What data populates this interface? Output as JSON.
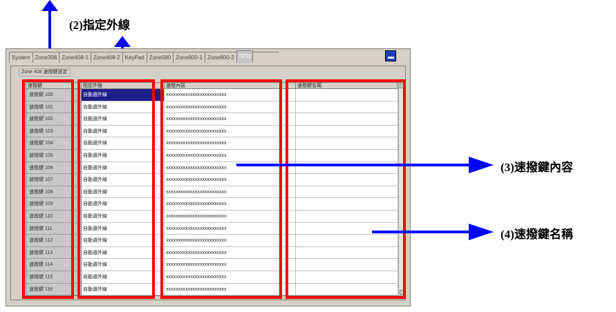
{
  "window": {
    "tabs": [
      "System",
      "Zone308",
      "Zone408-1",
      "Zone408-2",
      "KeyPad",
      "Zone580",
      "Zone600-1",
      "Zone600-2",
      "SPD"
    ],
    "active_tab": "SPD",
    "group_label": "Zone 408 速撥鍵設定"
  },
  "grid": {
    "columns": [
      "速撥鍵",
      "指定外線",
      "速撥內容",
      "速撥鍵名稱"
    ],
    "rows": [
      {
        "key": "速撥鍵 100",
        "line": "自動選外線",
        "content": "xxxxxxxxxxxxxxxxxxxxxxxxx",
        "name": ""
      },
      {
        "key": "速撥鍵 101",
        "line": "自動選外線",
        "content": "xxxxxxxxxxxxxxxxxxxxxxxxx",
        "name": ""
      },
      {
        "key": "速撥鍵 102",
        "line": "自動選外線",
        "content": "xxxxxxxxxxxxxxxxxxxxxxxxx",
        "name": ""
      },
      {
        "key": "速撥鍵 103",
        "line": "自動選外線",
        "content": "xxxxxxxxxxxxxxxxxxxxxxxxx",
        "name": ""
      },
      {
        "key": "速撥鍵 104",
        "line": "自動選外線",
        "content": "xxxxxxxxxxxxxxxxxxxxxxxxx",
        "name": ""
      },
      {
        "key": "速撥鍵 105",
        "line": "自動選外線",
        "content": "xxxxxxxxxxxxxxxxxxxxxxxxx",
        "name": ""
      },
      {
        "key": "速撥鍵 106",
        "line": "自動選外線",
        "content": "xxxxxxxxxxxxxxxxxxxxxxxxx",
        "name": ""
      },
      {
        "key": "速撥鍵 107",
        "line": "自動選外線",
        "content": "xxxxxxxxxxxxxxxxxxxxxxxxx",
        "name": ""
      },
      {
        "key": "速撥鍵 108",
        "line": "自動選外線",
        "content": "xxxxxxxxxxxxxxxxxxxxxxxxx",
        "name": ""
      },
      {
        "key": "速撥鍵 109",
        "line": "自動選外線",
        "content": "xxxxxxxxxxxxxxxxxxxxxxxxx",
        "name": ""
      },
      {
        "key": "速撥鍵 110",
        "line": "自動選外線",
        "content": "xxxxxxxxxxxxxxxxxxxxxxxxx",
        "name": ""
      },
      {
        "key": "速撥鍵 111",
        "line": "自動選外線",
        "content": "xxxxxxxxxxxxxxxxxxxxxxxxx",
        "name": ""
      },
      {
        "key": "速撥鍵 112",
        "line": "自動選外線",
        "content": "xxxxxxxxxxxxxxxxxxxxxxxxx",
        "name": ""
      },
      {
        "key": "速撥鍵 113",
        "line": "自動選外線",
        "content": "xxxxxxxxxxxxxxxxxxxxxxxxx",
        "name": ""
      },
      {
        "key": "速撥鍵 114",
        "line": "自動選外線",
        "content": "xxxxxxxxxxxxxxxxxxxxxxxxx",
        "name": ""
      },
      {
        "key": "速撥鍵 115",
        "line": "自動選外線",
        "content": "xxxxxxxxxxxxxxxxxxxxxxxxx",
        "name": ""
      },
      {
        "key": "速撥鍵 116",
        "line": "自動選外線",
        "content": "xxxxxxxxxxxxxxxxxxxxxxxxx",
        "name": ""
      }
    ]
  },
  "annotations": {
    "line_label": "(2)指定外線",
    "content_label": "(3)速撥鍵內容",
    "name_label": "(4)速撥鍵名稱",
    "arrow_color": "#0000ff",
    "box_color": "#ff0000"
  }
}
